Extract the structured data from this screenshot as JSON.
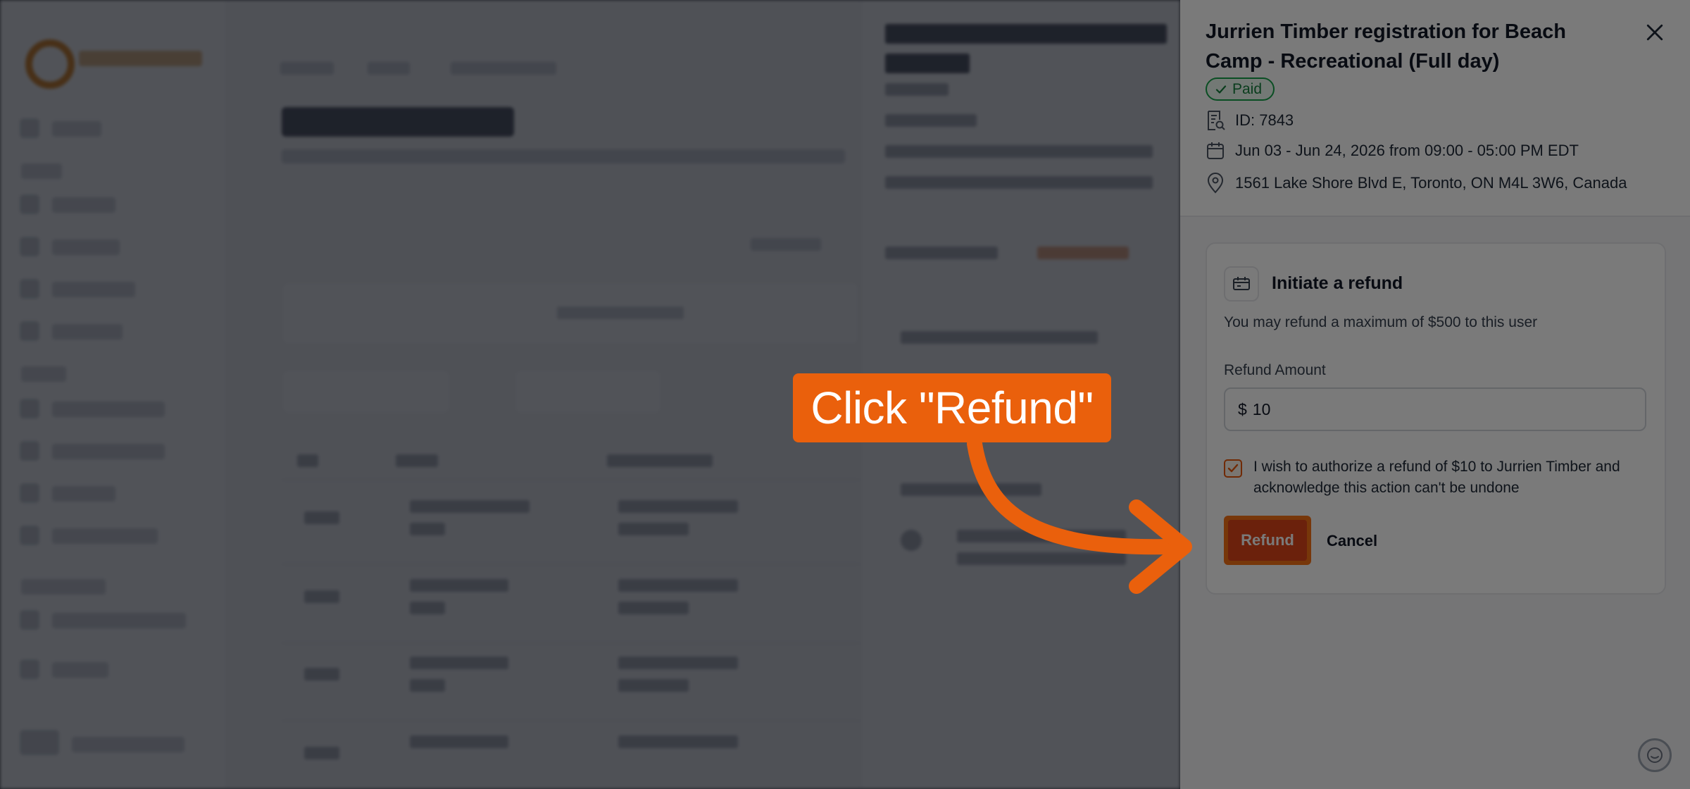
{
  "drawer": {
    "title": "Jurrien Timber registration for Beach Camp - Recreational (Full day)",
    "status_badge": "Paid",
    "id_text": "ID: 7843",
    "schedule_text": "Jun 03 - Jun 24, 2026 from 09:00 - 05:00 PM EDT",
    "location_text": "1561 Lake Shore Blvd E, Toronto, ON M4L 3W6, Canada"
  },
  "refund": {
    "heading": "Initiate a refund",
    "note": "You may refund a maximum of $500 to this user",
    "amount_label": "Refund Amount",
    "currency_symbol": "$",
    "amount_value": "10",
    "consent_text": "I wish to authorize a refund of $10 to Jurrien Timber and acknowledge this action can't be undone",
    "consent_checked": true,
    "refund_button": "Refund",
    "cancel_button": "Cancel"
  },
  "annotation": {
    "callout_text": "Click \"Refund\""
  },
  "icons": {
    "close": "close-icon",
    "paid_check": "check-icon",
    "id": "receipt-search-icon",
    "calendar": "calendar-icon",
    "location": "map-pin-icon",
    "refund": "refund-ticket-icon",
    "checkbox": "check-icon",
    "chat": "chat-support-icon"
  },
  "colors": {
    "accent_orange": "#ea600c",
    "refund_button": "#e0461a",
    "paid_green": "#16a34a"
  }
}
